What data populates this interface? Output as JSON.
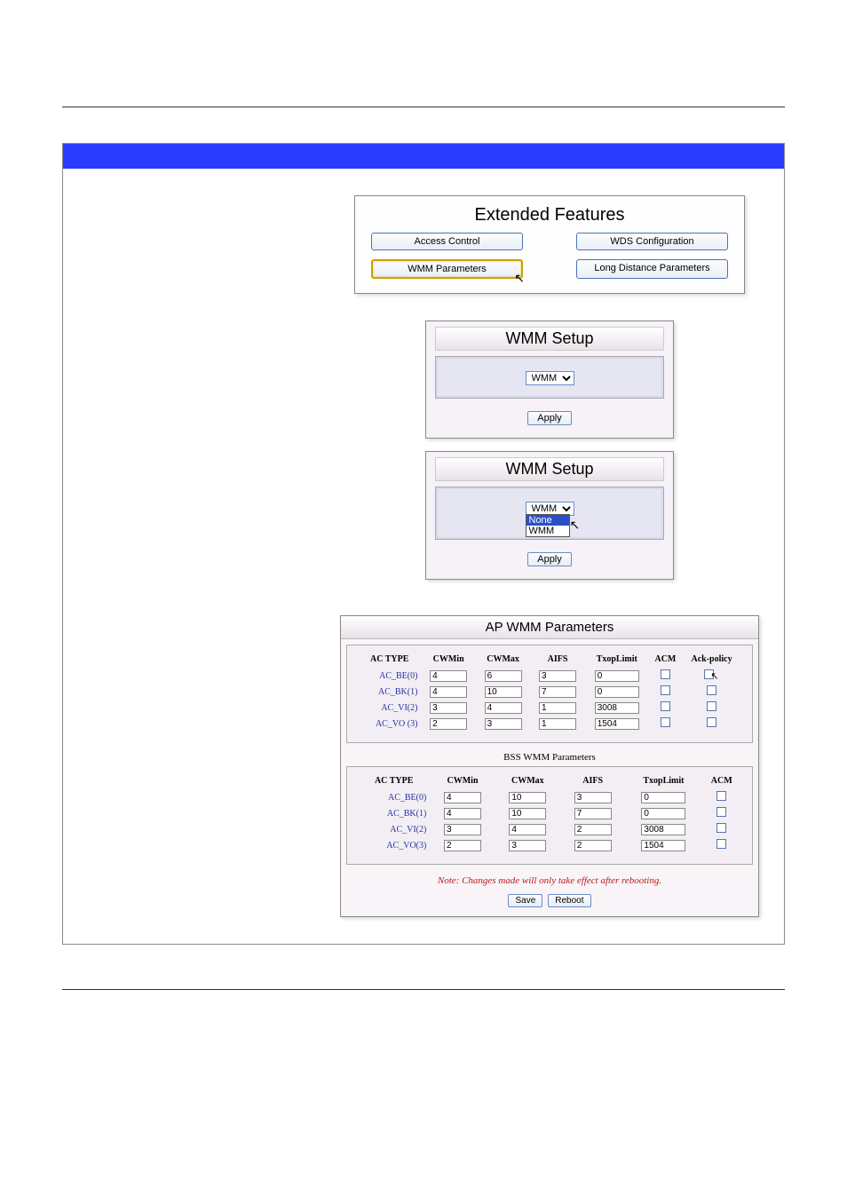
{
  "ext": {
    "title": "Extended Features",
    "btn_access": "Access Control",
    "btn_wds": "WDS Configuration",
    "btn_wmm": "WMM Parameters",
    "btn_long": "Long Distance Parameters"
  },
  "wmm1": {
    "title": "WMM Setup",
    "selected": "WMM",
    "apply": "Apply"
  },
  "wmm2": {
    "title": "WMM Setup",
    "selected": "WMM",
    "opt_none": "None",
    "opt_wmm": "WMM",
    "apply": "Apply"
  },
  "ap": {
    "title": "AP WMM Parameters",
    "headers": {
      "type": "AC TYPE",
      "cwmin": "CWMin",
      "cwmax": "CWMax",
      "aifs": "AIFS",
      "txop": "TxopLimit",
      "acm": "ACM",
      "ackp": "Ack-policy"
    },
    "rows": [
      {
        "label": "AC_BE(0)",
        "cwmin": "4",
        "cwmax": "6",
        "aifs": "3",
        "txop": "0"
      },
      {
        "label": "AC_BK(1)",
        "cwmin": "4",
        "cwmax": "10",
        "aifs": "7",
        "txop": "0"
      },
      {
        "label": "AC_VI(2)",
        "cwmin": "3",
        "cwmax": "4",
        "aifs": "1",
        "txop": "3008"
      },
      {
        "label": "AC_VO (3)",
        "cwmin": "2",
        "cwmax": "3",
        "aifs": "1",
        "txop": "1504"
      }
    ]
  },
  "bss": {
    "title": "BSS WMM Parameters",
    "headers": {
      "type": "AC TYPE",
      "cwmin": "CWMin",
      "cwmax": "CWMax",
      "aifs": "AIFS",
      "txop": "TxopLimit",
      "acm": "ACM"
    },
    "rows": [
      {
        "label": "AC_BE(0)",
        "cwmin": "4",
        "cwmax": "10",
        "aifs": "3",
        "txop": "0"
      },
      {
        "label": "AC_BK(1)",
        "cwmin": "4",
        "cwmax": "10",
        "aifs": "7",
        "txop": "0"
      },
      {
        "label": "AC_VI(2)",
        "cwmin": "3",
        "cwmax": "4",
        "aifs": "2",
        "txop": "3008"
      },
      {
        "label": "AC_VO(3)",
        "cwmin": "2",
        "cwmax": "3",
        "aifs": "2",
        "txop": "1504"
      }
    ]
  },
  "note": "Note: Changes made will only take effect after rebooting.",
  "save": "Save",
  "reboot": "Reboot"
}
